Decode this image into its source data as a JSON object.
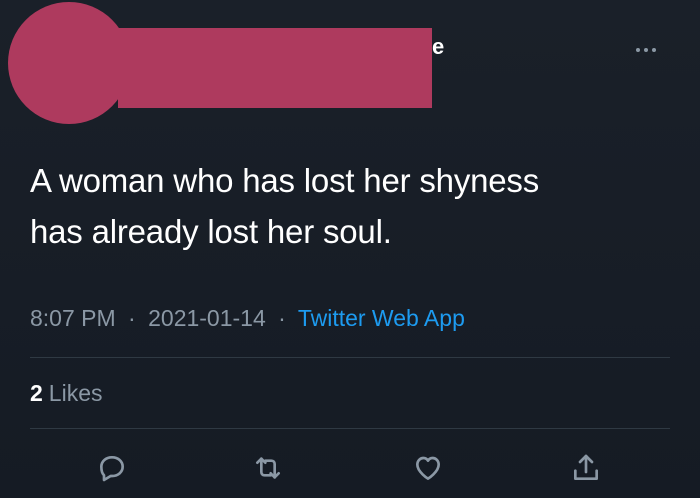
{
  "tweet": {
    "author_name_visible_fragment": "e",
    "text_line_1": "A woman who has lost her shyness",
    "text_line_2": "has already lost her soul.",
    "time": "8:07 PM",
    "date": "2021-01-14",
    "separator": "·",
    "source": "Twitter Web App",
    "likes_count": "2",
    "likes_label": "Likes"
  },
  "icons": {
    "more": "more-horizontal-icon",
    "reply": "reply-icon",
    "retweet": "retweet-icon",
    "like": "heart-icon",
    "share": "share-icon"
  },
  "colors": {
    "background": "#151b24",
    "text": "#ffffff",
    "muted": "#8b98a5",
    "link": "#1d9bf0",
    "redaction": "#ae3a5e",
    "divider": "#2f3943"
  }
}
